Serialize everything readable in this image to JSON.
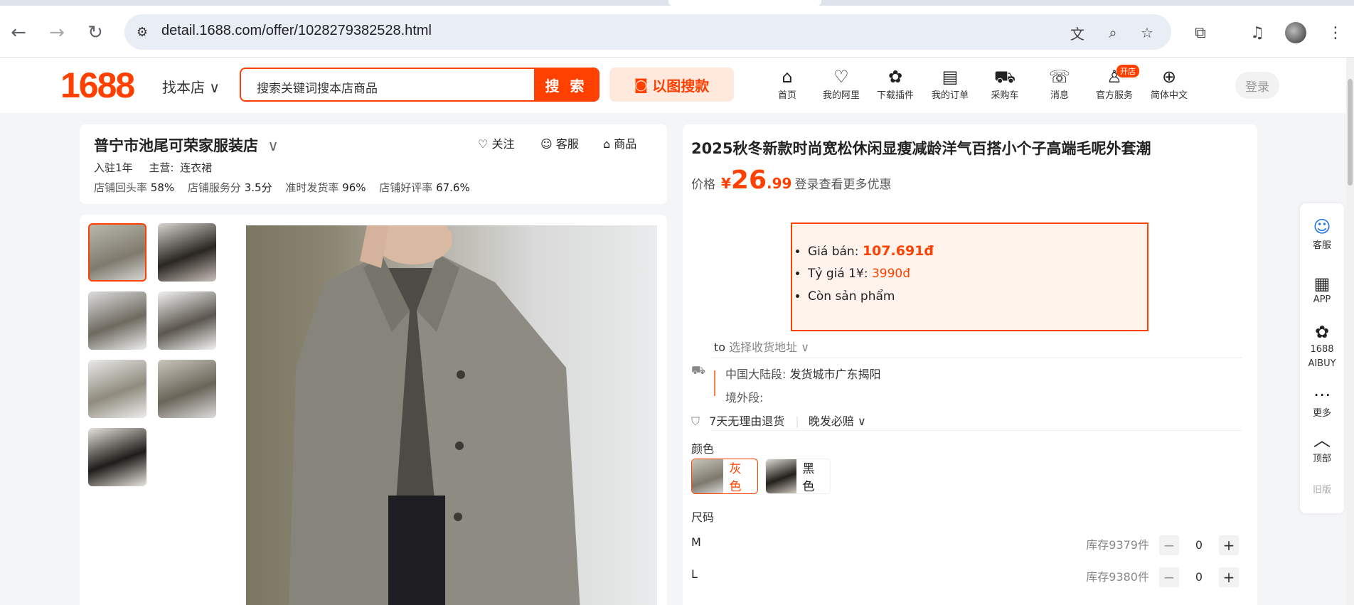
{
  "browser": {
    "url": "detail.1688.com/offer/1028279382528.html",
    "back_icon": "←",
    "forward_icon": "→",
    "reload_icon": "↻"
  },
  "header": {
    "logo": "1688",
    "find_shop": "找本店 ∨",
    "search_placeholder": "搜索关键词搜本店商品",
    "search_button": "搜 索",
    "image_search": "以图搜款",
    "nav": [
      {
        "label": "首页",
        "icon": "⌂"
      },
      {
        "label": "我的阿里",
        "icon": "♡"
      },
      {
        "label": "下载插件",
        "icon": "✿"
      },
      {
        "label": "我的订单",
        "icon": "▤"
      },
      {
        "label": "采购车",
        "icon": "⛟"
      },
      {
        "label": "消息",
        "icon": "☏"
      },
      {
        "label": "官方服务",
        "icon": "♙",
        "badge": "开店"
      },
      {
        "label": "简体中文",
        "icon": "⊕"
      }
    ],
    "login": "登录"
  },
  "shop": {
    "name": "普宁市池尾可荣家服装店",
    "joined": "入驻1年",
    "main_label": "主营:",
    "main_value": "连衣裙",
    "stats": [
      {
        "label": "店铺回头率",
        "value": "58%"
      },
      {
        "label": "店铺服务分",
        "value": "3.5分"
      },
      {
        "label": "准时发货率",
        "value": "96%"
      },
      {
        "label": "店铺好评率",
        "value": "67.6%"
      }
    ],
    "actions": {
      "follow": "关注",
      "service": "客服",
      "products": "商品"
    }
  },
  "product": {
    "title": "2025秋冬新款时尚宽松休闲显瘦减龄洋气百搭小个子高端毛呢外套潮",
    "price_label": "价格",
    "currency": "¥",
    "price_int": "26",
    "price_dec": ".99",
    "login_tip": "登录查看更多优惠",
    "vn": {
      "price_label": "Giá bán:",
      "price_value": "107.691đ",
      "rate_label": "Tỷ giá 1¥:",
      "rate_value": "3990đ",
      "stock": "Còn sản phẩm"
    },
    "ship_to": "to",
    "ship_select": "选择收货地址 ∨",
    "mainland_label": "中国大陆段:",
    "mainland_value": "发货城市广东揭阳",
    "overseas_label": "境外段:",
    "returns": "7天无理由退货",
    "late_pay": "晚发必赔 ∨",
    "color_label": "颜色",
    "colors": [
      "灰色",
      "黑色"
    ],
    "size_label": "尺码",
    "sizes": [
      {
        "name": "M",
        "stock": "库存9379件",
        "qty": "0"
      },
      {
        "name": "L",
        "stock": "库存9380件",
        "qty": "0"
      }
    ]
  },
  "sidebar": {
    "items": [
      "客服",
      "APP",
      "1688 AIBUY",
      "更多",
      "顶部",
      "旧版"
    ]
  },
  "colors": {
    "accent": "#ff4000",
    "accent_light": "#ffe8dc"
  }
}
